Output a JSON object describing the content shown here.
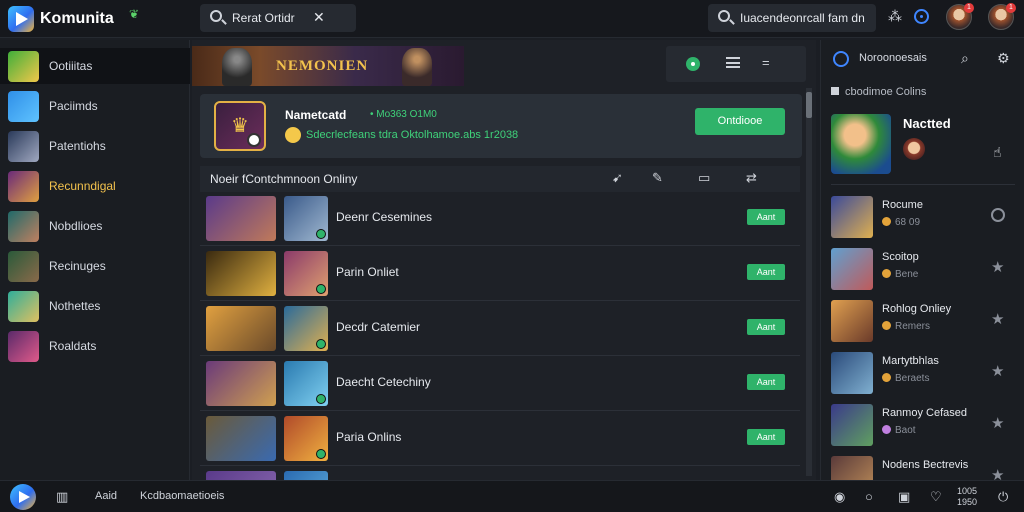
{
  "app": {
    "title": "Komunita"
  },
  "topbar": {
    "search_left_text": "Rerat Ortidr",
    "search_right_text": "Iuacendeonrcall fam dn",
    "avatar1_badge": "1",
    "avatar2_badge": "1"
  },
  "sidebar": {
    "items": [
      {
        "label": "Ootiiitas",
        "icon": "game-icon",
        "active": true
      },
      {
        "label": "Paciimds",
        "icon": "game-icon"
      },
      {
        "label": "Patentiohs",
        "icon": "game-icon"
      },
      {
        "label": "Recunndigal",
        "icon": "game-icon"
      },
      {
        "label": "Nobdlioes",
        "icon": "game-icon"
      },
      {
        "label": "Recinuges",
        "icon": "game-icon"
      },
      {
        "label": "Nothettes",
        "icon": "game-icon"
      },
      {
        "label": "Roaldats",
        "icon": "game-icon"
      }
    ]
  },
  "main": {
    "banner_text": "NEMONIEN",
    "featured": {
      "title": "Nametcatd",
      "meta": "• Mo363 O1M0",
      "subtitle": "Sdecrlecfeans tdra Oktolhamoe.abs 1r2038",
      "button_label": "Ontdiooe"
    },
    "list_title": "Noeir fContchmnoon Onliny",
    "rows": [
      {
        "title": "Deenr Cesemines",
        "button": "Aant"
      },
      {
        "title": "Parin Onliet",
        "button": "Aant"
      },
      {
        "title": "Decdr Catemier",
        "button": "Aant"
      },
      {
        "title": "Daecht Cetechiny",
        "button": "Aant"
      },
      {
        "title": "Paria Onlins",
        "button": "Aant"
      }
    ]
  },
  "right": {
    "title": "Noroonoesais",
    "section_label": "cbodimoe Colins",
    "featured_name": "Nactted",
    "items": [
      {
        "name": "Rocume",
        "sub": "68 09",
        "icon": "clock-icon"
      },
      {
        "name": "Scoitop",
        "sub": "Bene",
        "icon": "star-icon"
      },
      {
        "name": "Rohlog Onliey",
        "sub": "Remers",
        "icon": "star-icon"
      },
      {
        "name": "Martytbhlas",
        "sub": "Beraets",
        "icon": "star-icon"
      },
      {
        "name": "Ranmoy Cefased",
        "sub": "Baot",
        "icon": "star-icon"
      },
      {
        "name": "Nodens Bectrevis",
        "sub": "",
        "icon": "star-icon"
      }
    ]
  },
  "bottombar": {
    "label1": "Aaid",
    "label2": "Kcdbaomaetioeis",
    "time_line1": "1005",
    "time_line2": "1950"
  },
  "colors": {
    "accent_green": "#2fb36a",
    "accent_blue": "#3f86ff",
    "gold": "#f3c24d",
    "background": "#1b1e24"
  }
}
